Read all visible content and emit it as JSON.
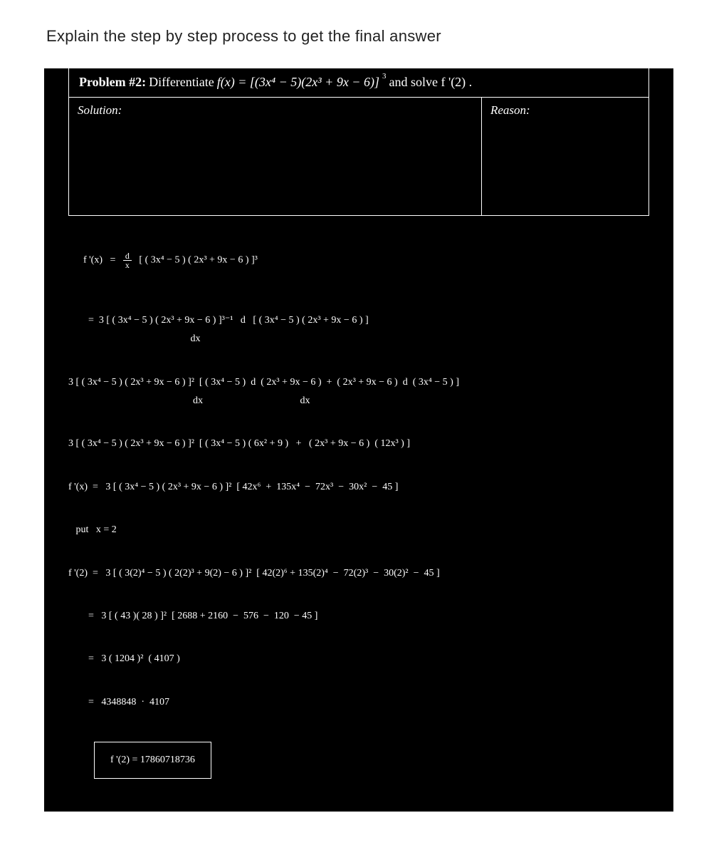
{
  "title": "Explain the step by step process to get the final answer",
  "problem": {
    "label": "Problem #2:",
    "text_before": " Differentiate ",
    "func": "f(x) = [(3x⁴ − 5)(2x³ + 9x − 6)]",
    "exp": "3",
    "text_after": " and solve  f '(2) ."
  },
  "solution_label": "Solution:",
  "reason_label": "Reason:",
  "steps": {
    "s1_left": "f '(x)   =   ",
    "s1_frac_top": "d",
    "s1_frac_bot": "x",
    "s1_right": "   [ ( 3x⁴ − 5 ) ( 2x³ + 9x − 6 ) ]³",
    "s2": "        =  3 [ ( 3x⁴ − 5 ) ( 2x³ + 9x − 6 ) ]³⁻¹   d   [ ( 3x⁴ − 5 ) ( 2x³ + 9x − 6 ) ]",
    "s2b": "                                                 dx",
    "s3": "3 [ ( 3x⁴ − 5 ) ( 2x³ + 9x − 6 ) ]²  [ ( 3x⁴ − 5 )  d  ( 2x³ + 9x − 6 )  +  ( 2x³ + 9x − 6 )  d  ( 3x⁴ − 5 ) ]",
    "s3b": "                                                  dx                                       dx",
    "s4": "3 [ ( 3x⁴ − 5 ) ( 2x³ + 9x − 6 ) ]²  [ ( 3x⁴ − 5 ) ( 6x² + 9 )   +   ( 2x³ + 9x − 6 )  ( 12x³ ) ]",
    "s5": "f '(x)  =   3 [ ( 3x⁴ − 5 ) ( 2x³ + 9x − 6 ) ]²  [ 42x⁶  +  135x⁴  −  72x³  −  30x²  −  45 ]",
    "put": "   put   x = 2",
    "s6": "f '(2)  =   3 [ ( 3(2)⁴ − 5 ) ( 2(2)³ + 9(2) − 6 ) ]²  [ 42(2)⁶ + 135(2)⁴  −  72(2)³  −  30(2)²  −  45 ]",
    "s7": "        =   3 [ ( 43 )( 28 ) ]²  [ 2688 + 2160  −  576  −  120  − 45 ]",
    "s8": "        =   3 ( 1204 )²  ( 4107 )",
    "s9": "        =   4348848  ·  4107",
    "final": "f '(2)  =  17860718736"
  }
}
